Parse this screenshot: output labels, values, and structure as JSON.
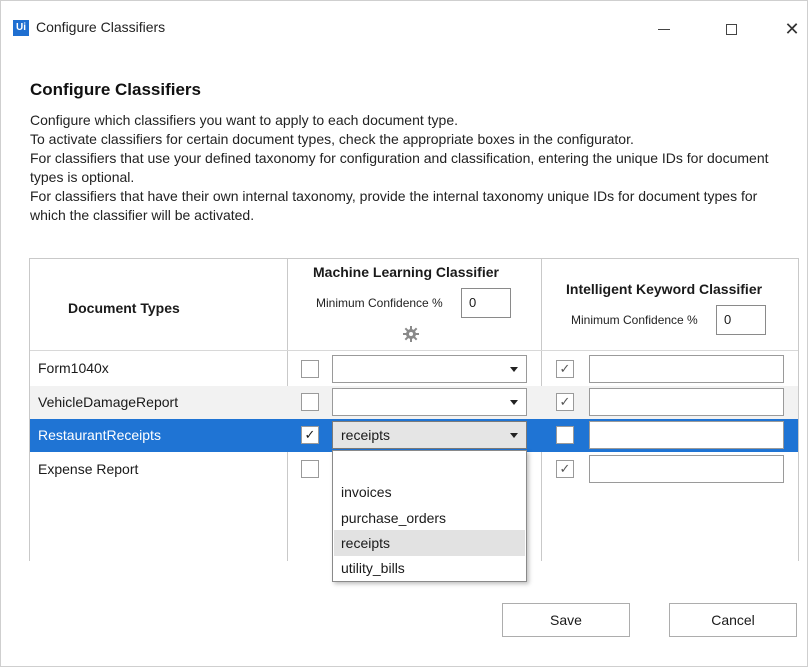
{
  "window": {
    "app_icon": "Ui",
    "title": "Configure Classifiers",
    "controls": [
      "minimize-icon",
      "maximize-icon",
      "close-icon"
    ]
  },
  "page": {
    "heading": "Configure Classifiers",
    "description": [
      "Configure which classifiers you want to apply to each document type.",
      "To activate classifiers for certain document types, check the appropriate boxes in the configurator.",
      "For classifiers that use your defined taxonomy for configuration and classification, entering the unique IDs for document types is optional.",
      "For classifiers that have their own internal taxonomy, provide the internal taxonomy unique IDs for document types for which the classifier will be activated."
    ]
  },
  "grid": {
    "col_document_types": "Document Types",
    "ml_classifier": {
      "title": "Machine Learning Classifier",
      "min_conf_label": "Minimum Confidence %",
      "min_conf_value": "0",
      "settings_icon": "gear-icon"
    },
    "ikc_classifier": {
      "title": "Intelligent Keyword Classifier",
      "min_conf_label": "Minimum Confidence %",
      "min_conf_value": "0"
    },
    "rows": [
      {
        "name": "Form1040x",
        "ml_checked": false,
        "ml_value": "",
        "ikc_checked": true,
        "ikc_value": "",
        "selected": false
      },
      {
        "name": "VehicleDamageReport",
        "ml_checked": false,
        "ml_value": "",
        "ikc_checked": true,
        "ikc_value": "",
        "selected": false
      },
      {
        "name": "RestaurantReceipts",
        "ml_checked": true,
        "ml_value": "receipts",
        "ikc_checked": false,
        "ikc_value": "",
        "selected": true
      },
      {
        "name": "Expense Report",
        "ml_checked": false,
        "ml_value": "",
        "ikc_checked": true,
        "ikc_value": "",
        "selected": false
      }
    ]
  },
  "dropdown": {
    "options": [
      "",
      "invoices",
      "purchase_orders",
      "receipts",
      "utility_bills"
    ],
    "highlighted": "receipts"
  },
  "footer": {
    "save_label": "Save",
    "cancel_label": "Cancel"
  },
  "colors": {
    "selection": "#1f74d4",
    "app_icon": "#1f6fd1"
  }
}
